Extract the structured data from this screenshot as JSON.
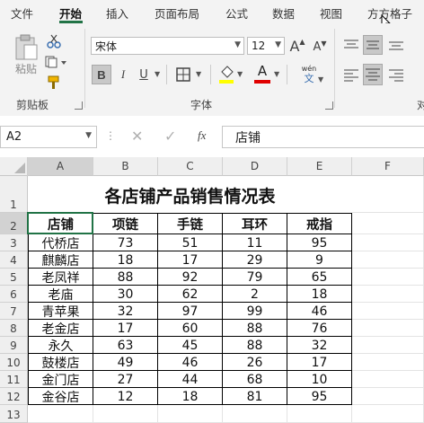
{
  "menu": [
    "文件",
    "开始",
    "插入",
    "页面布局",
    "公式",
    "数据",
    "视图",
    "方方格子"
  ],
  "ribbon": {
    "clipboard": {
      "paste_label": "粘贴",
      "group_label": "剪贴板"
    },
    "font": {
      "font_name": "宋体",
      "font_size": "12",
      "grow_label": "A",
      "shrink_label": "A",
      "bold": "B",
      "italic": "I",
      "underline": "U",
      "group_label": "字体"
    },
    "wen_label": "wén",
    "wen_sub": "文",
    "partial_label": "对"
  },
  "formula_bar": {
    "name_box": "A2",
    "fx_label": "fx",
    "content": "店铺"
  },
  "columns": [
    "A",
    "B",
    "C",
    "D",
    "E",
    "F"
  ],
  "rows": [
    "1",
    "2",
    "3",
    "4",
    "5",
    "6",
    "7",
    "8",
    "9",
    "10",
    "11",
    "12",
    "13"
  ],
  "sheet": {
    "title": "各店铺产品销售情况表",
    "headers": [
      "店铺",
      "项链",
      "手链",
      "耳环",
      "戒指"
    ],
    "data": [
      [
        "代桥店",
        "73",
        "51",
        "11",
        "95"
      ],
      [
        "麒麟店",
        "18",
        "17",
        "29",
        "9"
      ],
      [
        "老凤祥",
        "88",
        "92",
        "79",
        "65"
      ],
      [
        "老庙",
        "30",
        "62",
        "2",
        "18"
      ],
      [
        "青苹果",
        "32",
        "97",
        "99",
        "46"
      ],
      [
        "老金店",
        "17",
        "60",
        "88",
        "76"
      ],
      [
        "永久",
        "63",
        "45",
        "88",
        "32"
      ],
      [
        "鼓楼店",
        "49",
        "46",
        "26",
        "17"
      ],
      [
        "金门店",
        "27",
        "44",
        "68",
        "10"
      ],
      [
        "金谷店",
        "12",
        "18",
        "81",
        "95"
      ]
    ]
  },
  "colors": {
    "accent": "#217346",
    "font_highlight": "#ffff00",
    "font_color": "#e00000"
  }
}
